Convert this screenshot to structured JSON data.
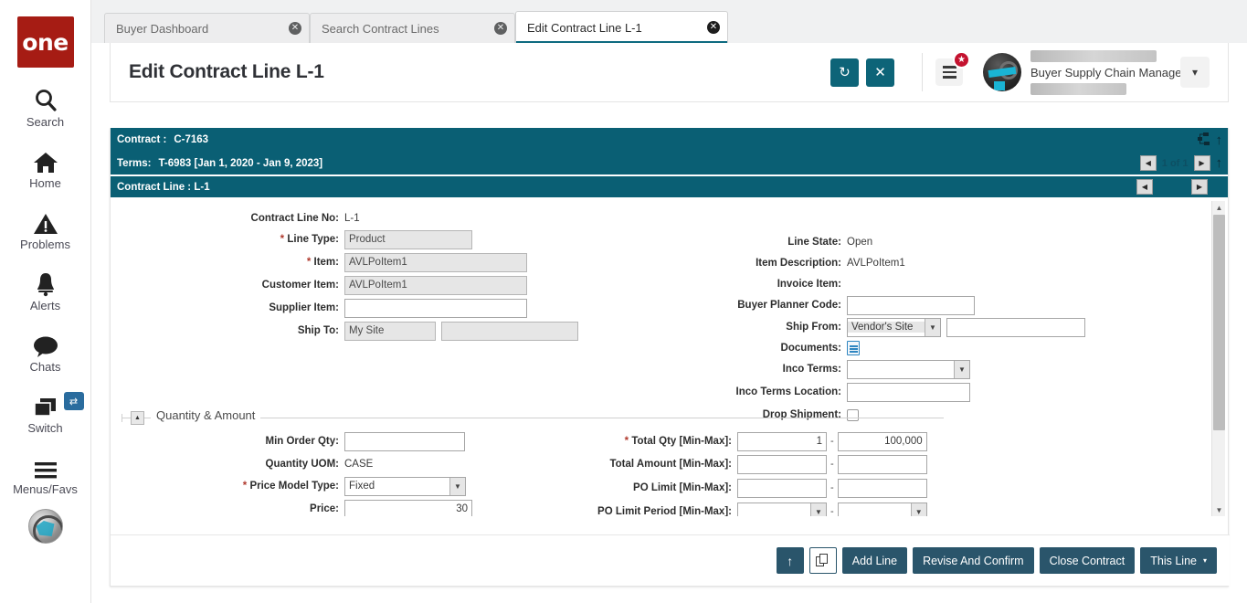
{
  "rail": {
    "logo_text": "one",
    "items": [
      {
        "label": "Search",
        "icon": "search-icon"
      },
      {
        "label": "Home",
        "icon": "home-icon"
      },
      {
        "label": "Problems",
        "icon": "warning-triangle-icon"
      },
      {
        "label": "Alerts",
        "icon": "bell-icon"
      },
      {
        "label": "Chats",
        "icon": "chat-bubble-icon"
      },
      {
        "label": "Switch",
        "icon": "windows-stack-icon",
        "badge": "⇄"
      },
      {
        "label": "Menus/Favs",
        "icon": "hamburger-icon"
      }
    ]
  },
  "tabs": [
    {
      "label": "Buyer Dashboard",
      "active": false,
      "close": "✕"
    },
    {
      "label": "Search Contract Lines",
      "active": false,
      "close": "✕"
    },
    {
      "label": "Edit Contract Line L-1",
      "active": true,
      "close": "✕"
    }
  ],
  "header": {
    "title": "Edit Contract Line L-1",
    "refresh_icon": "↻",
    "close_icon": "✕",
    "badge_star": "★",
    "user_role": "Buyer Supply Chain Manager",
    "caret": "▾"
  },
  "context_bars": {
    "contract_label": "Contract :",
    "contract_value": "C-7163",
    "terms_label": "Terms:",
    "terms_value": "T-6983 [Jan 1, 2020 - Jan 9, 2023]",
    "line_label": "Contract Line : L-1",
    "terms_pagination": "1 of 1",
    "prev_icon": "◀",
    "next_icon": "▶",
    "up_arrow": "↑",
    "tree_icon": "⎘"
  },
  "form": {
    "left": {
      "contract_line_no_label": "Contract Line No:",
      "contract_line_no_value": "L-1",
      "line_type_label": "Line Type:",
      "line_type_value": "Product",
      "item_label": "Item:",
      "item_value": "AVLPoItem1",
      "customer_item_label": "Customer Item:",
      "customer_item_value": "AVLPoItem1",
      "supplier_item_label": "Supplier Item:",
      "supplier_item_value": "",
      "ship_to_label": "Ship To:",
      "ship_to_value": "My Site",
      "ship_to_value2": ""
    },
    "right": {
      "line_state_label": "Line State:",
      "line_state_value": "Open",
      "item_description_label": "Item Description:",
      "item_description_value": "AVLPoItem1",
      "invoice_item_label": "Invoice Item:",
      "invoice_item_value": "",
      "buyer_planner_code_label": "Buyer Planner Code:",
      "buyer_planner_code_value": "",
      "ship_from_label": "Ship From:",
      "ship_from_value": "Vendor's Site",
      "ship_from_value2": "",
      "documents_label": "Documents:",
      "documents_icon": "document-icon",
      "inco_terms_label": "Inco Terms:",
      "inco_terms_value": "",
      "inco_terms_location_label": "Inco Terms Location:",
      "inco_terms_location_value": "",
      "drop_shipment_label": "Drop Shipment:",
      "drop_shipment_checked": false
    }
  },
  "section": {
    "title": "Quantity & Amount",
    "collapse_icon": "▲"
  },
  "qty": {
    "left": {
      "min_order_qty_label": "Min Order Qty:",
      "min_order_qty_value": "",
      "quantity_uom_label": "Quantity UOM:",
      "quantity_uom_value": "CASE",
      "price_model_type_label": "Price Model Type:",
      "price_model_type_value": "Fixed",
      "price_label": "Price:",
      "price_value": "30"
    },
    "right": {
      "total_qty_label": "Total Qty [Min-Max]:",
      "total_qty_min": "1",
      "total_qty_max": "100,000",
      "total_amount_label": "Total Amount [Min-Max]:",
      "total_amount_min": "",
      "total_amount_max": "",
      "po_limit_label": "PO Limit [Min-Max]:",
      "po_limit_min": "",
      "po_limit_max": "",
      "po_limit_period_label": "PO Limit Period [Min-Max]:",
      "po_limit_period_min": "",
      "po_limit_period_max": ""
    }
  },
  "footer": {
    "upload_icon": "↑",
    "copy_icon": "copy-icon",
    "add_line": "Add Line",
    "revise_and_confirm": "Revise And Confirm",
    "close_contract": "Close Contract",
    "this_line": "This Line",
    "this_line_caret": "▾"
  },
  "colors": {
    "teal": "#0a5f74",
    "teal_button": "#0d6478",
    "footer_button": "#2a556b",
    "brand_red": "#a61c14",
    "badge_red": "#c4122f"
  }
}
